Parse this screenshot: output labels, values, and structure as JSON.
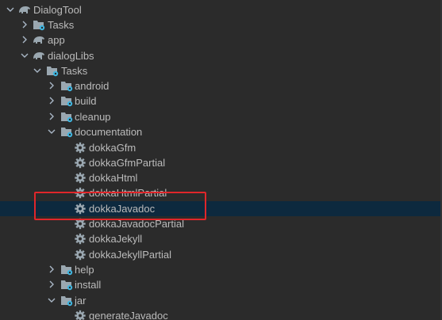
{
  "tree": {
    "rows": [
      {
        "label": "DialogTool",
        "chevron": "down",
        "icon": "elephant-icon"
      },
      {
        "label": "Tasks",
        "chevron": "right",
        "icon": "tasks-folder-icon"
      },
      {
        "label": "app",
        "chevron": "right",
        "icon": "elephant-icon"
      },
      {
        "label": "dialogLibs",
        "chevron": "down",
        "icon": "elephant-icon"
      },
      {
        "label": "Tasks",
        "chevron": "down",
        "icon": "tasks-folder-icon"
      },
      {
        "label": "android",
        "chevron": "right",
        "icon": "tasks-folder-icon"
      },
      {
        "label": "build",
        "chevron": "right",
        "icon": "tasks-folder-icon"
      },
      {
        "label": "cleanup",
        "chevron": "right",
        "icon": "tasks-folder-icon"
      },
      {
        "label": "documentation",
        "chevron": "down",
        "icon": "tasks-folder-icon"
      },
      {
        "label": "dokkaGfm",
        "chevron": "none",
        "icon": "gear-icon"
      },
      {
        "label": "dokkaGfmPartial",
        "chevron": "none",
        "icon": "gear-icon"
      },
      {
        "label": "dokkaHtml",
        "chevron": "none",
        "icon": "gear-icon"
      },
      {
        "label": "dokkaHtmlPartial",
        "chevron": "none",
        "icon": "gear-icon"
      },
      {
        "label": "dokkaJavadoc",
        "chevron": "none",
        "icon": "gear-icon",
        "selected": true
      },
      {
        "label": "dokkaJavadocPartial",
        "chevron": "none",
        "icon": "gear-icon"
      },
      {
        "label": "dokkaJekyll",
        "chevron": "none",
        "icon": "gear-icon"
      },
      {
        "label": "dokkaJekyllPartial",
        "chevron": "none",
        "icon": "gear-icon"
      },
      {
        "label": "help",
        "chevron": "right",
        "icon": "tasks-folder-icon"
      },
      {
        "label": "install",
        "chevron": "right",
        "icon": "tasks-folder-icon"
      },
      {
        "label": "jar",
        "chevron": "down",
        "icon": "tasks-folder-icon"
      },
      {
        "label": "generateJavadoc",
        "chevron": "none",
        "icon": "gear-icon"
      }
    ]
  },
  "colors": {
    "background": "#2b2b2b",
    "selected_row": "#0d293e",
    "highlight_border": "#e0262a",
    "text": "#bbbbbb",
    "icon_gray": "#9aa7b0",
    "icon_blue": "#40b6e0"
  }
}
